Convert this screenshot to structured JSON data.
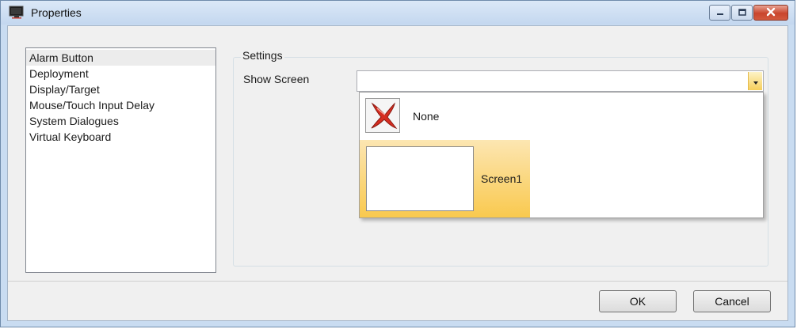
{
  "window": {
    "title": "Properties",
    "icon": "monitor-app-icon",
    "controls": [
      "minimize-icon",
      "maximize-icon",
      "close-icon"
    ]
  },
  "categories": [
    {
      "label": "Alarm Button",
      "selected": true
    },
    {
      "label": "Deployment",
      "selected": false
    },
    {
      "label": "Display/Target",
      "selected": false
    },
    {
      "label": "Mouse/Touch Input Delay",
      "selected": false
    },
    {
      "label": "System Dialogues",
      "selected": false
    },
    {
      "label": "Virtual Keyboard",
      "selected": false
    }
  ],
  "settings": {
    "group_label": "Settings",
    "show_screen_label": "Show Screen",
    "show_screen_value": "",
    "dropdown_open": true,
    "options": [
      {
        "label": "None",
        "icon": "red-x-icon",
        "highlighted": false
      },
      {
        "label": "Screen1",
        "icon": "screen-thumbnail",
        "highlighted": true
      }
    ]
  },
  "footer": {
    "ok_label": "OK",
    "cancel_label": "Cancel"
  },
  "colors": {
    "highlight_top": "#fce6b2",
    "highlight_bottom": "#f9c94e",
    "close_button": "#c9452c"
  }
}
